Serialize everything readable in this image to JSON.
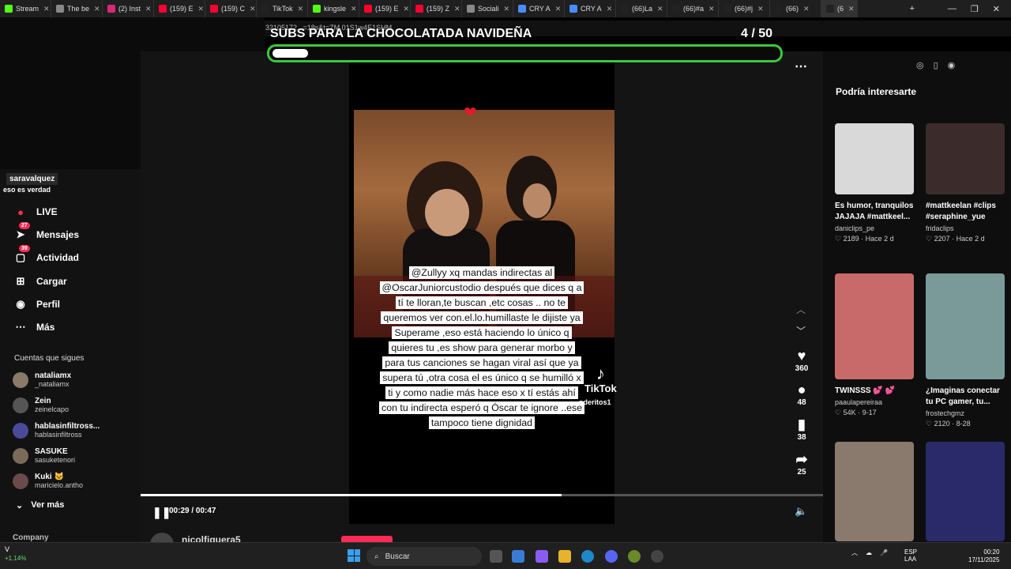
{
  "browser": {
    "tabs": [
      {
        "label": "Stream",
        "icon": "kick-icon",
        "color": "#53fc18"
      },
      {
        "label": "The be",
        "icon": "generic-icon",
        "color": "#888888"
      },
      {
        "label": "(2) Inst",
        "icon": "instagram-icon",
        "color": "#d62976"
      },
      {
        "label": "(159) E",
        "icon": "youtube-icon",
        "color": "#ff0033"
      },
      {
        "label": "(159) C",
        "icon": "youtube-icon",
        "color": "#ff0033"
      },
      {
        "label": "TikTok",
        "icon": "tiktok-icon",
        "color": "#222222"
      },
      {
        "label": "kingsle",
        "icon": "kick-icon",
        "color": "#53fc18"
      },
      {
        "label": "(159) E",
        "icon": "youtube-icon",
        "color": "#ff0033"
      },
      {
        "label": "(159) Z",
        "icon": "youtube-icon",
        "color": "#ff0033"
      },
      {
        "label": "Sociali",
        "icon": "generic-icon",
        "color": "#888888"
      },
      {
        "label": "CRY A",
        "icon": "search-icon",
        "color": "#4a8cff"
      },
      {
        "label": "CRY A",
        "icon": "search-icon",
        "color": "#4a8cff"
      },
      {
        "label": "(66)La",
        "icon": "tiktok-icon",
        "color": "#222222"
      },
      {
        "label": "(66)#a",
        "icon": "tiktok-icon",
        "color": "#222222"
      },
      {
        "label": "(66)#j",
        "icon": "tiktok-icon",
        "color": "#222222"
      },
      {
        "label": "(66)",
        "icon": "tiktok-icon",
        "color": "#222222"
      },
      {
        "label": "(6",
        "icon": "tiktok-icon",
        "color": "#222222"
      }
    ],
    "url_fragment": "32105172...=18s&t=ZM 01S1w4E1SHM",
    "new_tab": "+",
    "minimize": "—",
    "maximize": "❐",
    "close": "✕"
  },
  "overlay": {
    "title": "SUBS PARA LA CHOCOLATADA NAVIDEÑA",
    "count": "4  / 50",
    "progress_fraction": 0.08,
    "bar_color": "#39c93a"
  },
  "stream_chat": {
    "user": "saravalquez",
    "message": "eso es verdad"
  },
  "left_nav": {
    "items": [
      {
        "label": "LIVE",
        "icon": "live-icon",
        "badge": ""
      },
      {
        "label": "Mensajes",
        "icon": "send-icon",
        "badge": "27"
      },
      {
        "label": "Actividad",
        "icon": "inbox-icon",
        "badge": "39"
      },
      {
        "label": "Cargar",
        "icon": "plus-icon",
        "badge": ""
      },
      {
        "label": "Perfil",
        "icon": "profile-icon",
        "badge": ""
      },
      {
        "label": "Más",
        "icon": "more-icon",
        "badge": ""
      }
    ],
    "following_heading": "Cuentas que sigues",
    "accounts": [
      {
        "name": "nataliamx",
        "handle": "_nataliamx"
      },
      {
        "name": "Zein",
        "handle": "zeinelcapo"
      },
      {
        "name": "hablasinfiltross...",
        "handle": "hablasinfiltross"
      },
      {
        "name": "SASUKE",
        "handle": "sasuketenori"
      },
      {
        "name": "Kuki 🐱",
        "handle": "maricielo.antho"
      }
    ],
    "see_more": "Ver más",
    "company": "Company"
  },
  "video": {
    "caption": "@Zullyy  xq mandas indirectas al @OscarJuniorcustodio  después que dices q a tí te lloran,te buscan ,etc cosas .. no te queremos ver con.el.lo.humillaste le dijiste ya Superame ,eso está haciendo lo único q quieres tu ,es show para generar morbo y para tus canciones se hagan viral así que ya supera tú ,otra cosa el es único q se humilló x ti y como nadie más hace eso x tí estás ahí con tu indirecta esperó q Óscar te ignore ..ese tampoco tiene dignidad",
    "watermark_logo": "TikTok",
    "watermark_user": "nderitos1",
    "likes": "360",
    "comments": "48",
    "saves": "38",
    "shares": "25",
    "time": "00:29 / 00:47",
    "progress_fraction": 0.617,
    "author": "nicolfiguera5"
  },
  "recommendations": {
    "title": "Podría interesarte",
    "cards": [
      {
        "title": "Es humor, tranquilos JAJAJA #mattkeel...",
        "user": "daniclips_pe",
        "likes": "2189",
        "date": "Hace 2 d",
        "color": "#d9d9d9"
      },
      {
        "title": "#mattkeelan #clips #seraphine_yue",
        "user": "fridaclips",
        "likes": "2207",
        "date": "Hace 2 d",
        "color": "#3b2b2b"
      },
      {
        "title": "TWINSSS 💕 💕",
        "user": "paaulapereiraa",
        "likes": "54K",
        "date": "9-17",
        "color": "#c96a6a"
      },
      {
        "title": "¿Imaginas conectar tu PC gamer, tu...",
        "user": "frostechgmz",
        "likes": "2120",
        "date": "8-28",
        "color": "#7a9a9a"
      },
      {
        "title": "",
        "user": "",
        "likes": "",
        "date": "",
        "color": "#8a7a6e"
      },
      {
        "title": "",
        "user": "",
        "likes": "",
        "date": "",
        "color": "#2a2a6a"
      }
    ]
  },
  "taskbar": {
    "weather_temp": "V",
    "weather_change": "+1.14%",
    "search_label": "Buscar",
    "lang": "ESP",
    "lang2": "LAA",
    "time": "00:20",
    "date": "17/11/2025"
  }
}
